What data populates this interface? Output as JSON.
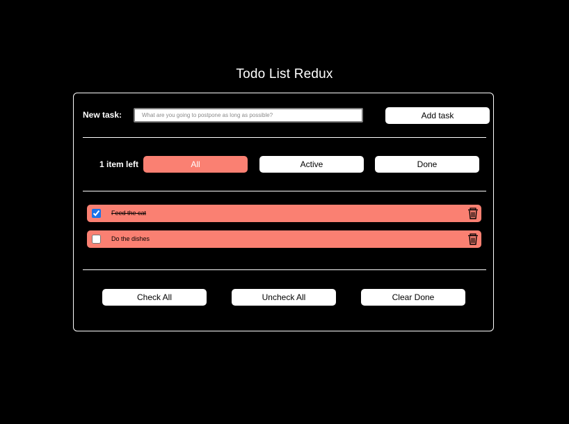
{
  "app": {
    "title": "Todo List Redux"
  },
  "new_task": {
    "label": "New task:",
    "placeholder": "What are you going to postpone as long as possible?",
    "value": "",
    "add_button": "Add task"
  },
  "filters": {
    "items_left": "1 item left",
    "all": "All",
    "active": "Active",
    "done": "Done",
    "selected": "All"
  },
  "todos": [
    {
      "text": "Feed the cat",
      "checked": true
    },
    {
      "text": "Do the dishes",
      "checked": false
    }
  ],
  "actions": {
    "check_all": "Check All",
    "uncheck_all": "Uncheck All",
    "clear_done": "Clear Done"
  },
  "colors": {
    "accent": "#fa8072",
    "background": "#000000",
    "panel_border": "#ffffff",
    "button_bg": "#ffffff"
  },
  "icons": {
    "delete": "trash-icon"
  }
}
